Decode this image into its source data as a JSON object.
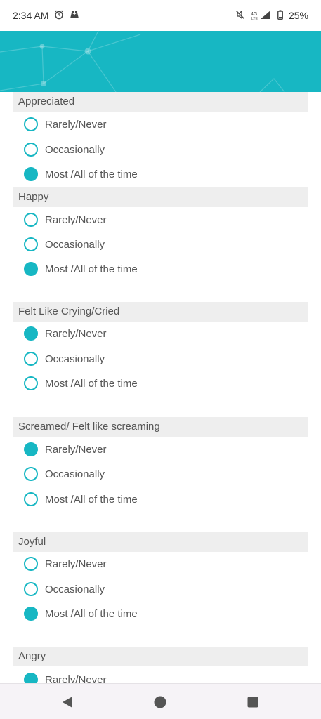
{
  "status_bar": {
    "time": "2:34 AM",
    "battery": "25%",
    "icons": [
      "alarm-icon",
      "notification-icon",
      "mute-icon",
      "lte-signal-icon",
      "battery-icon"
    ]
  },
  "options": {
    "rarely": "Rarely/Never",
    "occasionally": "Occasionally",
    "most": "Most /All of the time"
  },
  "questions": [
    {
      "title": "Appreciated",
      "selected": "most"
    },
    {
      "title": "Happy",
      "selected": "most"
    },
    {
      "title": "Felt Like Crying/Cried",
      "selected": "rarely"
    },
    {
      "title": "Screamed/ Felt like screaming",
      "selected": "rarely"
    },
    {
      "title": "Joyful",
      "selected": "most"
    },
    {
      "title": "Angry",
      "selected": "rarely"
    }
  ],
  "colors": {
    "accent": "#17b7c3",
    "title_background": "#eeeeee",
    "text": "#555555"
  },
  "nav_bar": {
    "icons": [
      "back-icon",
      "home-icon",
      "recents-icon"
    ]
  }
}
